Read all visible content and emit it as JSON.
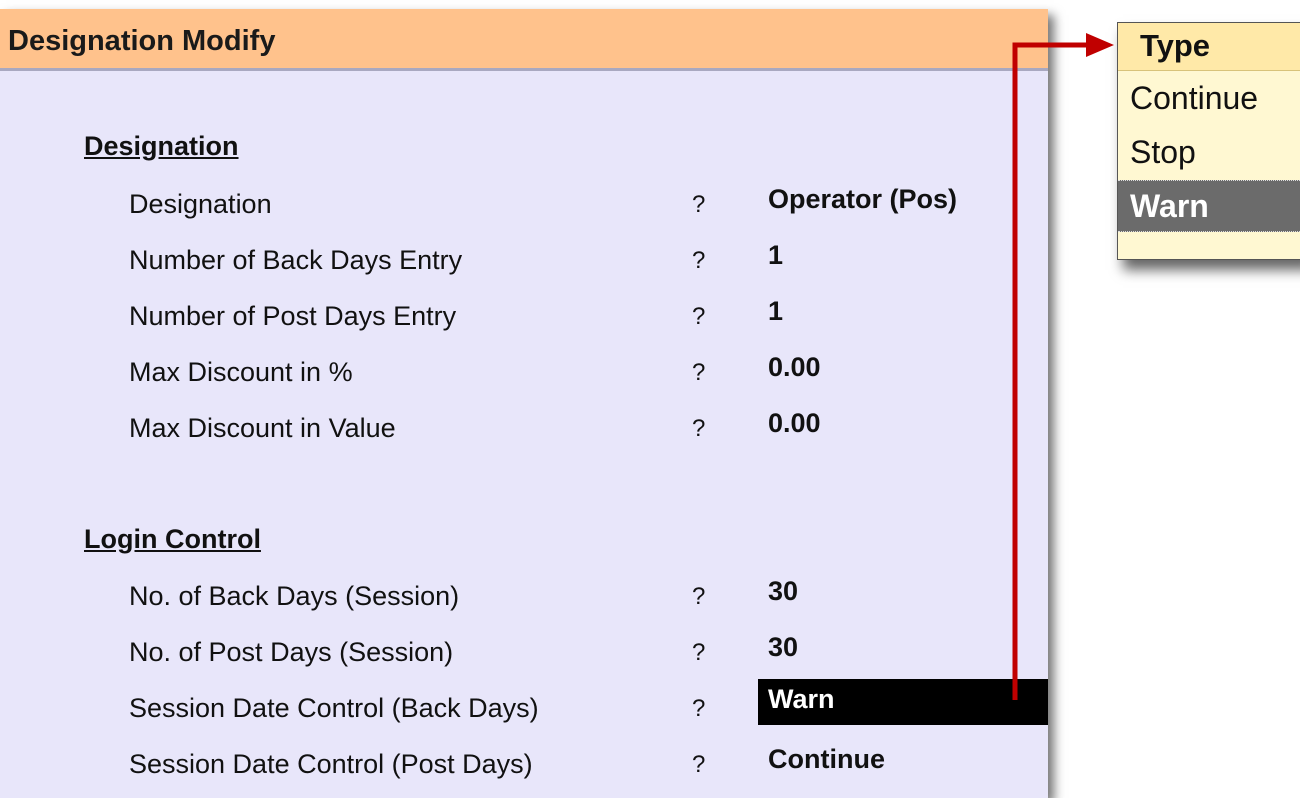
{
  "window": {
    "title": "Designation Modify"
  },
  "sections": {
    "designation": {
      "heading": "Designation",
      "fields": [
        {
          "label": "Designation",
          "q": "?",
          "value": "Operator (Pos)"
        },
        {
          "label": "Number of Back Days Entry",
          "q": "?",
          "value": "1"
        },
        {
          "label": "Number of Post Days Entry",
          "q": "?",
          "value": "1"
        },
        {
          "label": "Max Discount in %",
          "q": "?",
          "value": "0.00"
        },
        {
          "label": "Max Discount in Value",
          "q": "?",
          "value": "0.00"
        }
      ]
    },
    "login_control": {
      "heading": "Login Control",
      "fields": [
        {
          "label": "No. of Back Days (Session)",
          "q": "?",
          "value": "30"
        },
        {
          "label": "No. of Post Days (Session)",
          "q": "?",
          "value": "30"
        },
        {
          "label": "Session Date Control (Back Days)",
          "q": "?",
          "value": "Warn",
          "selected": true
        },
        {
          "label": "Session Date Control (Post Days)",
          "q": "?",
          "value": "Continue"
        }
      ]
    }
  },
  "popup": {
    "header": "Type",
    "options": [
      "Continue",
      "Stop",
      "Warn"
    ],
    "selected": "Warn"
  },
  "colors": {
    "title_bar": "#ffc28c",
    "panel_bg": "#e8e6fa",
    "popup_bg": "#fff8d2",
    "popup_header": "#ffe9a8",
    "selected_bg": "#6b6b6b",
    "arrow": "#c00000"
  }
}
